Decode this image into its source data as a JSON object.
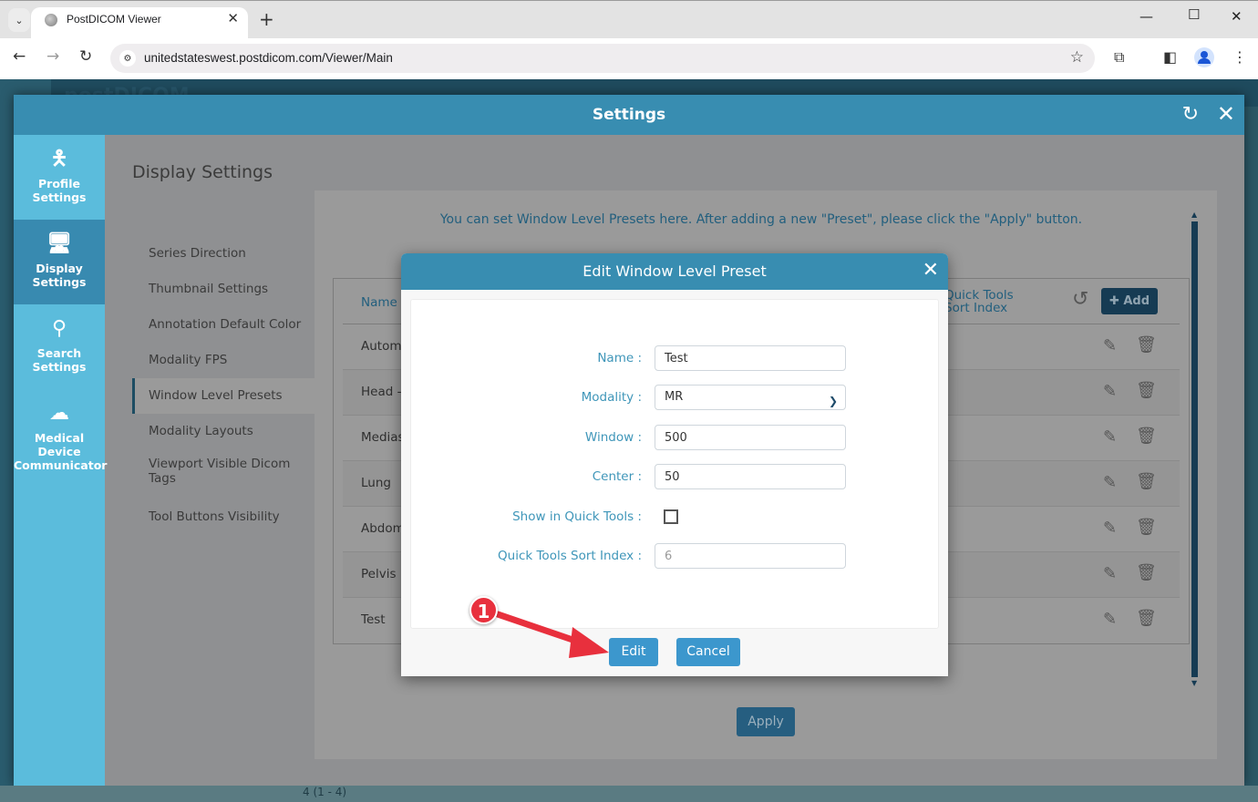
{
  "browser": {
    "tab_title": "PostDICOM Viewer",
    "url": "unitedstateswest.postdicom.com/Viewer/Main"
  },
  "app": {
    "logo_text": "postDICOM",
    "footer_text": "4 (1 - 4)"
  },
  "settings": {
    "title": "Settings",
    "side_nav": [
      {
        "label_line1": "Profile",
        "label_line2": "Settings",
        "active": false
      },
      {
        "label_line1": "Display",
        "label_line2": "Settings",
        "active": true
      },
      {
        "label_line1": "Search",
        "label_line2": "Settings",
        "active": false
      },
      {
        "label_line1": "Medical Device",
        "label_line2": "Communicator",
        "active": false
      }
    ],
    "content_title": "Display Settings",
    "sub_nav": [
      "Series Direction",
      "Thumbnail Settings",
      "Annotation Default Color",
      "Modality FPS",
      "Window Level Presets",
      "Modality Layouts",
      "Viewport Visible Dicom Tags",
      "Tool Buttons Visibility"
    ],
    "active_sub_nav": "Window Level Presets",
    "info_text": "You can set Window Level Presets here. After adding a new \"Preset\", please click the \"Apply\" button.",
    "table": {
      "col_name": "Name",
      "col_quick_tools_line1": "Quick Tools",
      "col_quick_tools_line2": "Sort Index",
      "add_label": "Add",
      "rows": [
        "Autom",
        "Head -",
        "Medias",
        "Lung",
        "Abdom",
        "Pelvis E",
        "Test"
      ]
    },
    "apply_label": "Apply"
  },
  "modal": {
    "title": "Edit Window Level Preset",
    "fields": {
      "name_label": "Name :",
      "name_value": "Test",
      "modality_label": "Modality :",
      "modality_value": "MR",
      "window_label": "Window :",
      "window_value": "500",
      "center_label": "Center :",
      "center_value": "50",
      "show_quick_label": "Show in Quick Tools :",
      "show_quick_checked": false,
      "sort_index_label": "Quick Tools Sort Index :",
      "sort_index_value": "6"
    },
    "edit_label": "Edit",
    "cancel_label": "Cancel"
  },
  "annotation": {
    "step_number": "1",
    "color": "#e8303d"
  }
}
